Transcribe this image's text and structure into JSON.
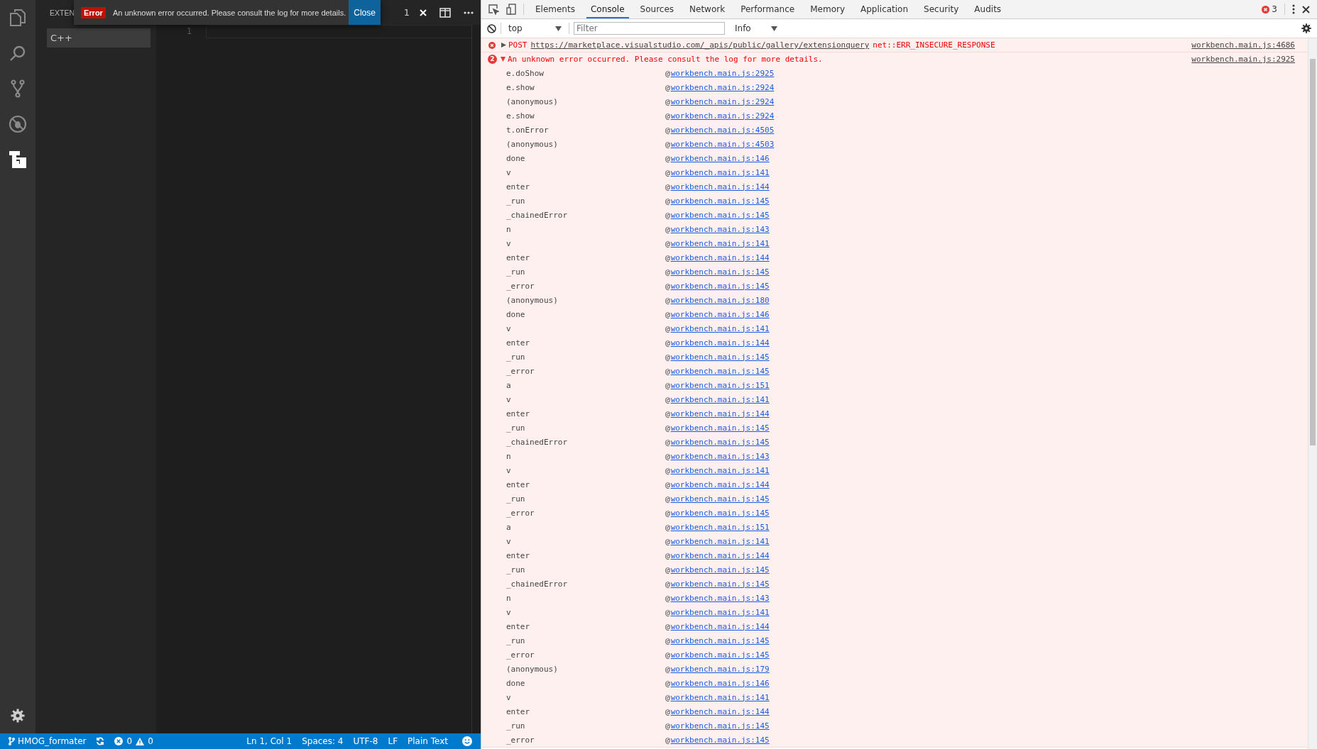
{
  "editor_window": {
    "activity_bar": [
      {
        "kind": "files",
        "selected": false
      },
      {
        "kind": "search",
        "selected": false
      },
      {
        "kind": "source-control",
        "selected": false
      },
      {
        "kind": "debug",
        "selected": false
      },
      {
        "kind": "extensions",
        "selected": true
      }
    ],
    "sidebar": {
      "title": "EXTEN",
      "items": [
        {
          "label": "C++",
          "selected": true
        }
      ]
    },
    "editor": {
      "tab_badge": "1",
      "line_numbers": [
        "1"
      ]
    },
    "notification": {
      "severity": "Error",
      "message": "An unknown error occurred. Please consult the log for more details.",
      "button": "Close"
    },
    "status_bar": {
      "branch": "HMOG_formater",
      "errors": "0",
      "warnings": "0",
      "position": "Ln 1, Col 1",
      "indentation": "Spaces: 4",
      "encoding": "UTF-8",
      "line_ending": "LF",
      "language": "Plain Text"
    }
  },
  "devtools": {
    "tabs": [
      {
        "label": "Elements",
        "selected": false
      },
      {
        "label": "Console",
        "selected": true
      },
      {
        "label": "Sources",
        "selected": false
      },
      {
        "label": "Network",
        "selected": false
      },
      {
        "label": "Performance",
        "selected": false
      },
      {
        "label": "Memory",
        "selected": false
      },
      {
        "label": "Application",
        "selected": false
      },
      {
        "label": "Security",
        "selected": false
      },
      {
        "label": "Audits",
        "selected": false
      }
    ],
    "error_count": "3",
    "context": "top",
    "filter": {
      "placeholder": "Filter"
    },
    "level": "Info",
    "messages": [
      {
        "kind": "request",
        "expanded": false,
        "method": "POST",
        "url": "https://marketplace.visualstudio.com/_apis/public/gallery/extensionquery",
        "status": "net::ERR_INSECURE_RESPONSE",
        "source": "workbench.main.js:4686"
      },
      {
        "kind": "error",
        "expanded": true,
        "count": "2",
        "text": "An unknown error occurred. Please consult the log for more details.",
        "source": "workbench.main.js:2925",
        "stack": [
          {
            "function": "e.doShow",
            "at": "@",
            "location": "workbench.main.js:2925"
          },
          {
            "function": "e.show",
            "at": "@",
            "location": "workbench.main.js:2924"
          },
          {
            "function": "(anonymous)",
            "at": "@",
            "location": "workbench.main.js:2924"
          },
          {
            "function": "e.show",
            "at": "@",
            "location": "workbench.main.js:2924"
          },
          {
            "function": "t.onError",
            "at": "@",
            "location": "workbench.main.js:4505"
          },
          {
            "function": "(anonymous)",
            "at": "@",
            "location": "workbench.main.js:4503"
          },
          {
            "function": "done",
            "at": "@",
            "location": "workbench.main.js:146"
          },
          {
            "function": "v",
            "at": "@",
            "location": "workbench.main.js:141"
          },
          {
            "function": "enter",
            "at": "@",
            "location": "workbench.main.js:144"
          },
          {
            "function": "_run",
            "at": "@",
            "location": "workbench.main.js:145"
          },
          {
            "function": "_chainedError",
            "at": "@",
            "location": "workbench.main.js:145"
          },
          {
            "function": "n",
            "at": "@",
            "location": "workbench.main.js:143"
          },
          {
            "function": "v",
            "at": "@",
            "location": "workbench.main.js:141"
          },
          {
            "function": "enter",
            "at": "@",
            "location": "workbench.main.js:144"
          },
          {
            "function": "_run",
            "at": "@",
            "location": "workbench.main.js:145"
          },
          {
            "function": "_error",
            "at": "@",
            "location": "workbench.main.js:145"
          },
          {
            "function": "(anonymous)",
            "at": "@",
            "location": "workbench.main.js:180"
          },
          {
            "function": "done",
            "at": "@",
            "location": "workbench.main.js:146"
          },
          {
            "function": "v",
            "at": "@",
            "location": "workbench.main.js:141"
          },
          {
            "function": "enter",
            "at": "@",
            "location": "workbench.main.js:144"
          },
          {
            "function": "_run",
            "at": "@",
            "location": "workbench.main.js:145"
          },
          {
            "function": "_error",
            "at": "@",
            "location": "workbench.main.js:145"
          },
          {
            "function": "a",
            "at": "@",
            "location": "workbench.main.js:151"
          },
          {
            "function": "v",
            "at": "@",
            "location": "workbench.main.js:141"
          },
          {
            "function": "enter",
            "at": "@",
            "location": "workbench.main.js:144"
          },
          {
            "function": "_run",
            "at": "@",
            "location": "workbench.main.js:145"
          },
          {
            "function": "_chainedError",
            "at": "@",
            "location": "workbench.main.js:145"
          },
          {
            "function": "n",
            "at": "@",
            "location": "workbench.main.js:143"
          },
          {
            "function": "v",
            "at": "@",
            "location": "workbench.main.js:141"
          },
          {
            "function": "enter",
            "at": "@",
            "location": "workbench.main.js:144"
          },
          {
            "function": "_run",
            "at": "@",
            "location": "workbench.main.js:145"
          },
          {
            "function": "_error",
            "at": "@",
            "location": "workbench.main.js:145"
          },
          {
            "function": "a",
            "at": "@",
            "location": "workbench.main.js:151"
          },
          {
            "function": "v",
            "at": "@",
            "location": "workbench.main.js:141"
          },
          {
            "function": "enter",
            "at": "@",
            "location": "workbench.main.js:144"
          },
          {
            "function": "_run",
            "at": "@",
            "location": "workbench.main.js:145"
          },
          {
            "function": "_chainedError",
            "at": "@",
            "location": "workbench.main.js:145"
          },
          {
            "function": "n",
            "at": "@",
            "location": "workbench.main.js:143"
          },
          {
            "function": "v",
            "at": "@",
            "location": "workbench.main.js:141"
          },
          {
            "function": "enter",
            "at": "@",
            "location": "workbench.main.js:144"
          },
          {
            "function": "_run",
            "at": "@",
            "location": "workbench.main.js:145"
          },
          {
            "function": "_error",
            "at": "@",
            "location": "workbench.main.js:145"
          },
          {
            "function": "(anonymous)",
            "at": "@",
            "location": "workbench.main.js:179"
          },
          {
            "function": "done",
            "at": "@",
            "location": "workbench.main.js:146"
          },
          {
            "function": "v",
            "at": "@",
            "location": "workbench.main.js:141"
          },
          {
            "function": "enter",
            "at": "@",
            "location": "workbench.main.js:144"
          },
          {
            "function": "_run",
            "at": "@",
            "location": "workbench.main.js:145"
          },
          {
            "function": "_error",
            "at": "@",
            "location": "workbench.main.js:145"
          }
        ]
      }
    ]
  }
}
